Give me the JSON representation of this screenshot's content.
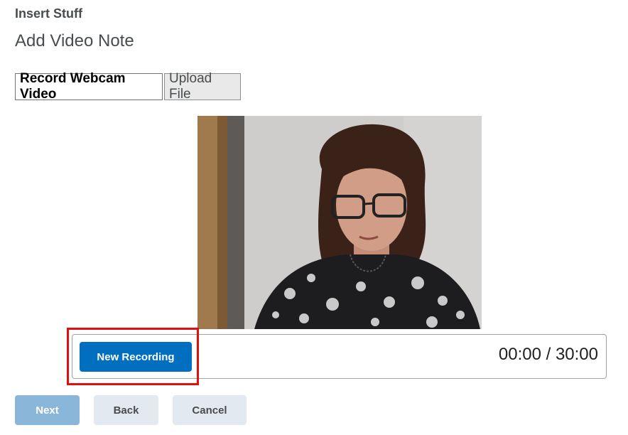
{
  "dialog": {
    "title": "Insert Stuff",
    "section_title": "Add Video Note"
  },
  "tabs": [
    {
      "label": "Record Webcam Video",
      "active": true
    },
    {
      "label": "Upload File",
      "active": false
    }
  ],
  "recorder": {
    "new_recording_label": "New Recording",
    "timer": "00:00 / 30:00",
    "preview": "webcam-preview"
  },
  "footer": {
    "next_label": "Next",
    "back_label": "Back",
    "cancel_label": "Cancel"
  },
  "colors": {
    "primary": "#006fbf",
    "primary_disabled": "#8ab6d9",
    "highlight": "#e30f0f"
  }
}
